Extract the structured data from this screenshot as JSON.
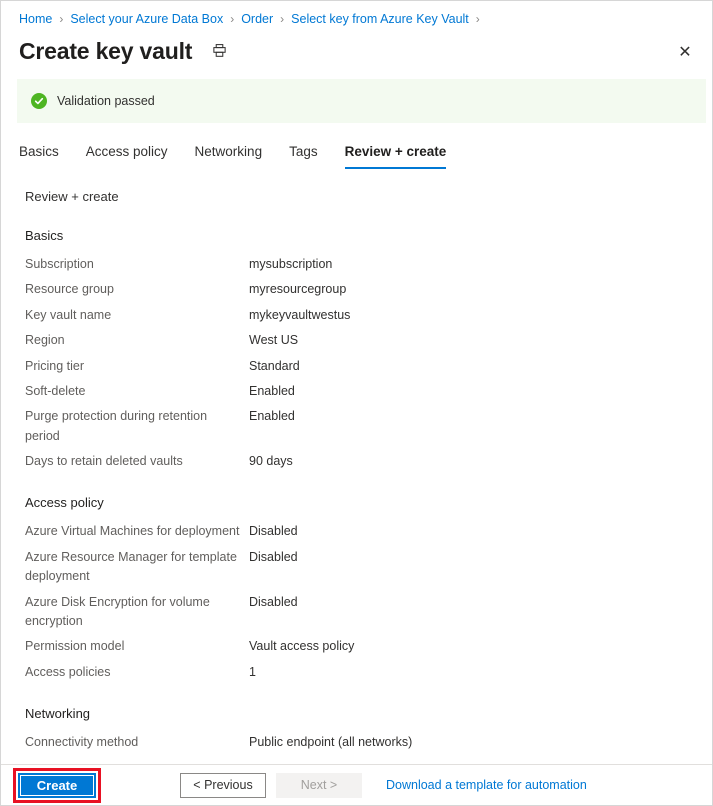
{
  "breadcrumb": {
    "items": [
      {
        "label": "Home"
      },
      {
        "label": "Select your Azure Data Box"
      },
      {
        "label": "Order"
      },
      {
        "label": "Select key from Azure Key Vault"
      }
    ],
    "separator": "›"
  },
  "header": {
    "title": "Create key vault",
    "print_icon": "printer-icon",
    "close_icon": "close-icon",
    "close_glyph": "✕"
  },
  "banner": {
    "icon": "success-check-icon",
    "glyph": "✓",
    "text": "Validation passed",
    "background": "#f3faf0",
    "icon_color": "#4eb523"
  },
  "tabs": [
    {
      "label": "Basics",
      "active": false
    },
    {
      "label": "Access policy",
      "active": false
    },
    {
      "label": "Networking",
      "active": false
    },
    {
      "label": "Tags",
      "active": false
    },
    {
      "label": "Review + create",
      "active": true
    }
  ],
  "main": {
    "lead": "Review + create",
    "sections": [
      {
        "title": "Basics",
        "rows": [
          {
            "key": "Subscription",
            "value": "mysubscription"
          },
          {
            "key": "Resource group",
            "value": "myresourcegroup"
          },
          {
            "key": "Key vault name",
            "value": "mykeyvaultwestus"
          },
          {
            "key": "Region",
            "value": "West US"
          },
          {
            "key": "Pricing tier",
            "value": "Standard"
          },
          {
            "key": "Soft-delete",
            "value": "Enabled"
          },
          {
            "key": "Purge protection during retention period",
            "value": "Enabled"
          },
          {
            "key": "Days to retain deleted vaults",
            "value": "90 days"
          }
        ]
      },
      {
        "title": "Access policy",
        "rows": [
          {
            "key": "Azure Virtual Machines for deployment",
            "value": "Disabled"
          },
          {
            "key": "Azure Resource Manager for template deployment",
            "value": "Disabled"
          },
          {
            "key": "Azure Disk Encryption for volume encryption",
            "value": "Disabled"
          },
          {
            "key": "Permission model",
            "value": "Vault access policy"
          },
          {
            "key": "Access policies",
            "value": "1"
          }
        ]
      },
      {
        "title": "Networking",
        "rows": [
          {
            "key": "Connectivity method",
            "value": "Public endpoint (all networks)"
          }
        ]
      }
    ]
  },
  "footer": {
    "create_label": "Create",
    "previous_label": "< Previous",
    "next_label": "Next >",
    "download_label": "Download a template for automation",
    "highlight_color": "#e81123",
    "accent_color": "#0078d4"
  }
}
